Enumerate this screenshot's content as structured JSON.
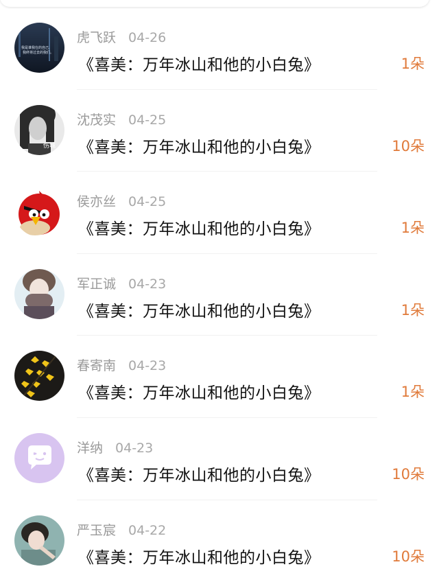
{
  "records": [
    {
      "name": "虎飞跃",
      "date": "04-26",
      "title": "《喜美：万年冰山和他的小白兔》",
      "flowers": "1朵",
      "avatar": "night-photo-avatar"
    },
    {
      "name": "沈茂实",
      "date": "04-25",
      "title": "《喜美：万年冰山和他的小白兔》",
      "flowers": "10朵",
      "avatar": "girl-bw-avatar"
    },
    {
      "name": "侯亦丝",
      "date": "04-25",
      "title": "《喜美：万年冰山和他的小白兔》",
      "flowers": "1朵",
      "avatar": "angry-bird-avatar"
    },
    {
      "name": "军正诚",
      "date": "04-23",
      "title": "《喜美：万年冰山和他的小白兔》",
      "flowers": "1朵",
      "avatar": "girl-scarf-avatar"
    },
    {
      "name": "春寄南",
      "date": "04-23",
      "title": "《喜美：万年冰山和他的小白兔》",
      "flowers": "1朵",
      "avatar": "yellow-flowers-avatar"
    },
    {
      "name": "洋纳",
      "date": "04-23",
      "title": "《喜美：万年冰山和他的小白兔》",
      "flowers": "10朵",
      "avatar": "default-chat-avatar"
    },
    {
      "name": "严玉宸",
      "date": "04-22",
      "title": "《喜美：万年冰山和他的小白兔》",
      "flowers": "10朵",
      "avatar": "girl-photo-avatar"
    }
  ],
  "avatar_text": {
    "night_photo_line1": "我是谁我在的自己,",
    "night_photo_line2": "我终将过去的我们。",
    "girl_bw": "伤城"
  },
  "colors": {
    "name": "#9a9a9a",
    "title": "#111111",
    "flowers": "#e07a3a",
    "divider": "#f1f1f1"
  }
}
